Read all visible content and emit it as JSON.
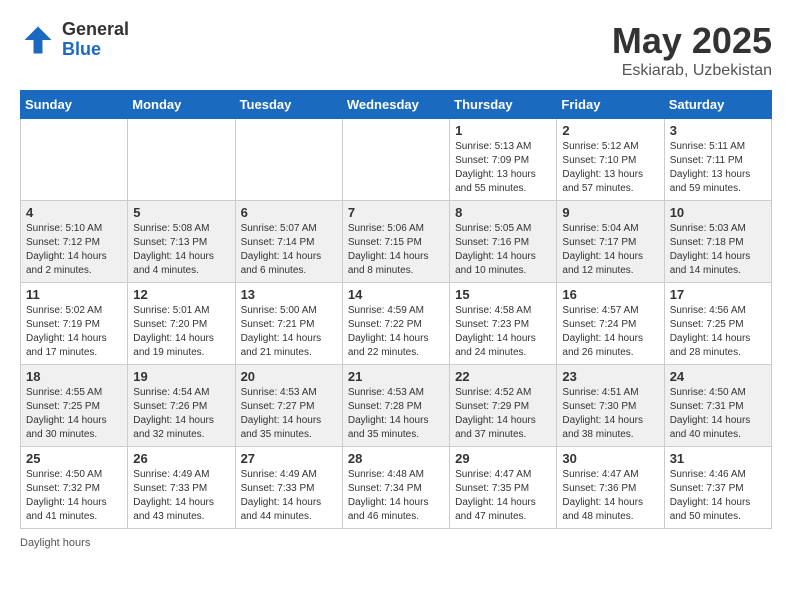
{
  "header": {
    "logo_general": "General",
    "logo_blue": "Blue",
    "title": "May 2025",
    "location": "Eskiarab, Uzbekistan"
  },
  "footer": {
    "label": "Daylight hours"
  },
  "days_of_week": [
    "Sunday",
    "Monday",
    "Tuesday",
    "Wednesday",
    "Thursday",
    "Friday",
    "Saturday"
  ],
  "weeks": [
    [
      {
        "day": "",
        "info": ""
      },
      {
        "day": "",
        "info": ""
      },
      {
        "day": "",
        "info": ""
      },
      {
        "day": "",
        "info": ""
      },
      {
        "day": "1",
        "info": "Sunrise: 5:13 AM\nSunset: 7:09 PM\nDaylight: 13 hours\nand 55 minutes."
      },
      {
        "day": "2",
        "info": "Sunrise: 5:12 AM\nSunset: 7:10 PM\nDaylight: 13 hours\nand 57 minutes."
      },
      {
        "day": "3",
        "info": "Sunrise: 5:11 AM\nSunset: 7:11 PM\nDaylight: 13 hours\nand 59 minutes."
      }
    ],
    [
      {
        "day": "4",
        "info": "Sunrise: 5:10 AM\nSunset: 7:12 PM\nDaylight: 14 hours\nand 2 minutes."
      },
      {
        "day": "5",
        "info": "Sunrise: 5:08 AM\nSunset: 7:13 PM\nDaylight: 14 hours\nand 4 minutes."
      },
      {
        "day": "6",
        "info": "Sunrise: 5:07 AM\nSunset: 7:14 PM\nDaylight: 14 hours\nand 6 minutes."
      },
      {
        "day": "7",
        "info": "Sunrise: 5:06 AM\nSunset: 7:15 PM\nDaylight: 14 hours\nand 8 minutes."
      },
      {
        "day": "8",
        "info": "Sunrise: 5:05 AM\nSunset: 7:16 PM\nDaylight: 14 hours\nand 10 minutes."
      },
      {
        "day": "9",
        "info": "Sunrise: 5:04 AM\nSunset: 7:17 PM\nDaylight: 14 hours\nand 12 minutes."
      },
      {
        "day": "10",
        "info": "Sunrise: 5:03 AM\nSunset: 7:18 PM\nDaylight: 14 hours\nand 14 minutes."
      }
    ],
    [
      {
        "day": "11",
        "info": "Sunrise: 5:02 AM\nSunset: 7:19 PM\nDaylight: 14 hours\nand 17 minutes."
      },
      {
        "day": "12",
        "info": "Sunrise: 5:01 AM\nSunset: 7:20 PM\nDaylight: 14 hours\nand 19 minutes."
      },
      {
        "day": "13",
        "info": "Sunrise: 5:00 AM\nSunset: 7:21 PM\nDaylight: 14 hours\nand 21 minutes."
      },
      {
        "day": "14",
        "info": "Sunrise: 4:59 AM\nSunset: 7:22 PM\nDaylight: 14 hours\nand 22 minutes."
      },
      {
        "day": "15",
        "info": "Sunrise: 4:58 AM\nSunset: 7:23 PM\nDaylight: 14 hours\nand 24 minutes."
      },
      {
        "day": "16",
        "info": "Sunrise: 4:57 AM\nSunset: 7:24 PM\nDaylight: 14 hours\nand 26 minutes."
      },
      {
        "day": "17",
        "info": "Sunrise: 4:56 AM\nSunset: 7:25 PM\nDaylight: 14 hours\nand 28 minutes."
      }
    ],
    [
      {
        "day": "18",
        "info": "Sunrise: 4:55 AM\nSunset: 7:25 PM\nDaylight: 14 hours\nand 30 minutes."
      },
      {
        "day": "19",
        "info": "Sunrise: 4:54 AM\nSunset: 7:26 PM\nDaylight: 14 hours\nand 32 minutes."
      },
      {
        "day": "20",
        "info": "Sunrise: 4:53 AM\nSunset: 7:27 PM\nDaylight: 14 hours\nand 35 minutes."
      },
      {
        "day": "21",
        "info": "Sunrise: 4:53 AM\nSunset: 7:28 PM\nDaylight: 14 hours\nand 35 minutes."
      },
      {
        "day": "22",
        "info": "Sunrise: 4:52 AM\nSunset: 7:29 PM\nDaylight: 14 hours\nand 37 minutes."
      },
      {
        "day": "23",
        "info": "Sunrise: 4:51 AM\nSunset: 7:30 PM\nDaylight: 14 hours\nand 38 minutes."
      },
      {
        "day": "24",
        "info": "Sunrise: 4:50 AM\nSunset: 7:31 PM\nDaylight: 14 hours\nand 40 minutes."
      }
    ],
    [
      {
        "day": "25",
        "info": "Sunrise: 4:50 AM\nSunset: 7:32 PM\nDaylight: 14 hours\nand 41 minutes."
      },
      {
        "day": "26",
        "info": "Sunrise: 4:49 AM\nSunset: 7:33 PM\nDaylight: 14 hours\nand 43 minutes."
      },
      {
        "day": "27",
        "info": "Sunrise: 4:49 AM\nSunset: 7:33 PM\nDaylight: 14 hours\nand 44 minutes."
      },
      {
        "day": "28",
        "info": "Sunrise: 4:48 AM\nSunset: 7:34 PM\nDaylight: 14 hours\nand 46 minutes."
      },
      {
        "day": "29",
        "info": "Sunrise: 4:47 AM\nSunset: 7:35 PM\nDaylight: 14 hours\nand 47 minutes."
      },
      {
        "day": "30",
        "info": "Sunrise: 4:47 AM\nSunset: 7:36 PM\nDaylight: 14 hours\nand 48 minutes."
      },
      {
        "day": "31",
        "info": "Sunrise: 4:46 AM\nSunset: 7:37 PM\nDaylight: 14 hours\nand 50 minutes."
      }
    ]
  ]
}
